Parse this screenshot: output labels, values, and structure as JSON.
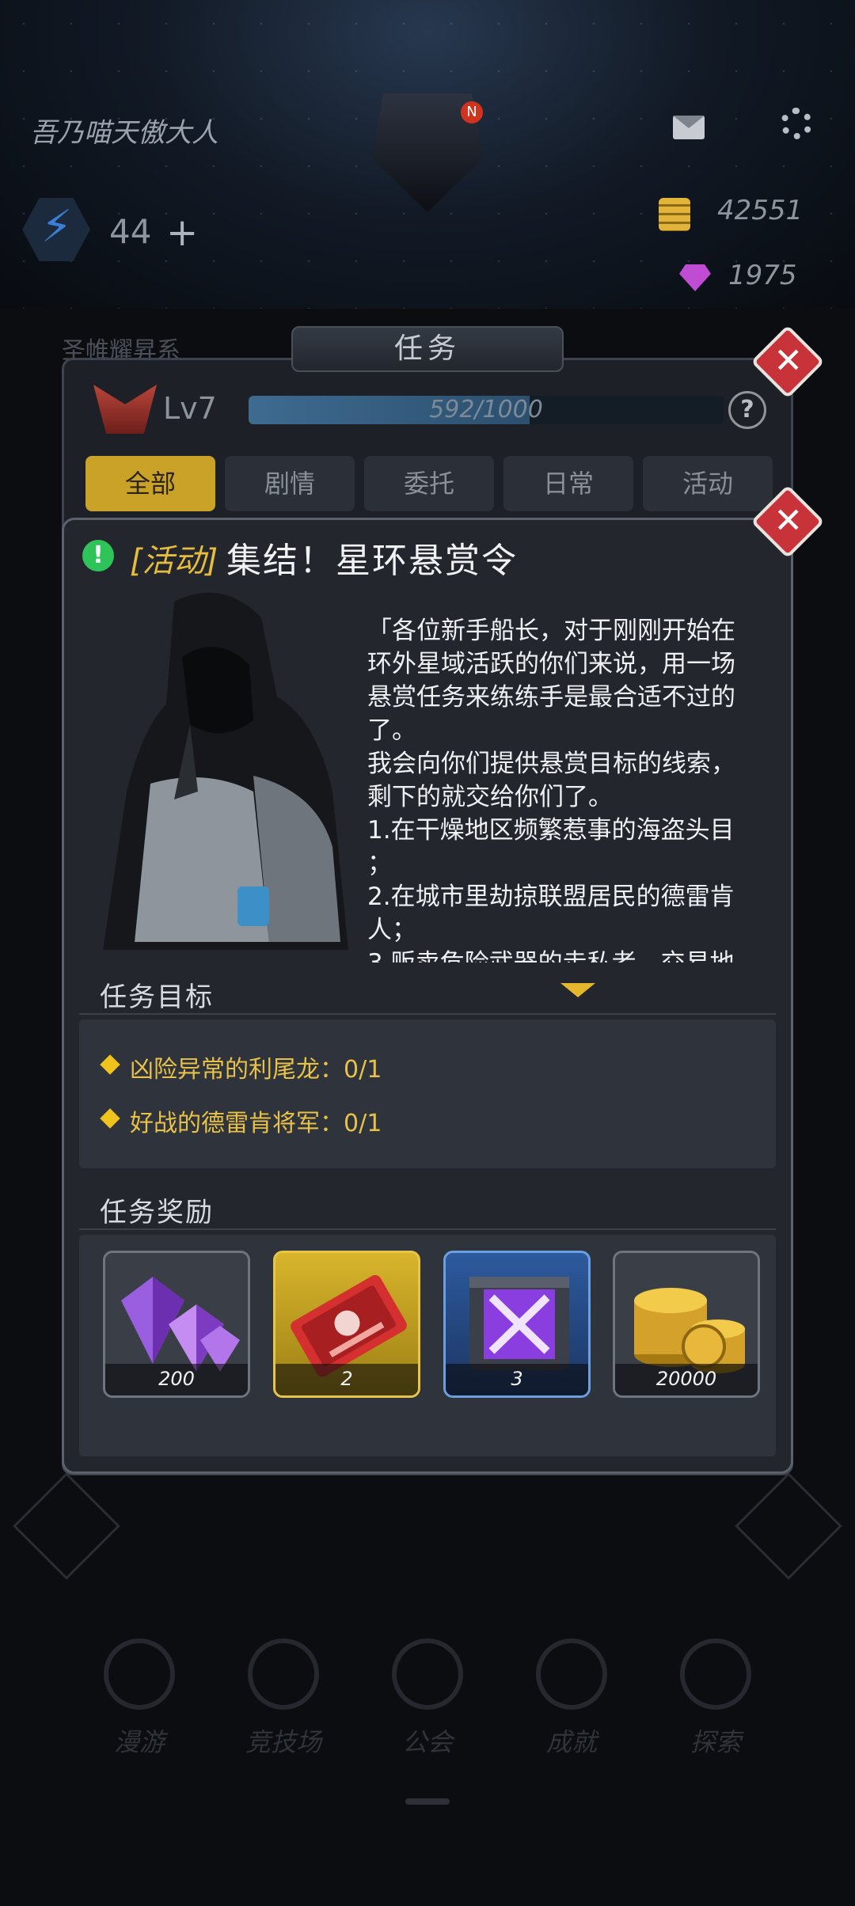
{
  "header": {
    "player_name": "吾乃喵天傲大人",
    "avatar_badge": "N",
    "energy": "44",
    "energy_add": "+",
    "coins": "42551",
    "gems": "1975"
  },
  "background": {
    "partial_text": "圣帷耀昇系",
    "nav": [
      {
        "label": "漫游"
      },
      {
        "label": "竞技场"
      },
      {
        "label": "公会"
      },
      {
        "label": "成就"
      },
      {
        "label": "探索"
      }
    ]
  },
  "mission_panel": {
    "title": "任务",
    "level": "Lv7",
    "xp": 592,
    "xp_max": 1000,
    "xp_text": "592/1000",
    "help": "?",
    "close": "✕",
    "tabs": [
      {
        "label": "全部",
        "active": true
      },
      {
        "label": "剧情",
        "active": false
      },
      {
        "label": "委托",
        "active": false
      },
      {
        "label": "日常",
        "active": false
      },
      {
        "label": "活动",
        "active": false
      }
    ]
  },
  "detail": {
    "close": "✕",
    "alert": "!",
    "tag": "[活动]",
    "title": "集结！星环悬赏令",
    "story": "「各位新手船长，对于刚刚开始在\n环外星域活跃的你们来说，用一场\n悬赏任务来练练手是最合适不过的\n了。\n我会向你们提供悬赏目标的线索，\n剩下的就交给你们了。\n1.在干燥地区频繁惹事的海盗头目\n；\n2.在城市里劫掠联盟居民的德雷肯\n人；\n3.贩卖危险武器的走私者，交易地",
    "objectives_title": "任务目标",
    "objectives": [
      {
        "text": "凶险异常的利尾龙：0/1"
      },
      {
        "text": "好战的德雷肯将军：0/1"
      }
    ],
    "rewards_title": "任务奖励",
    "rewards": [
      {
        "icon": "purple-gems-icon",
        "count": "200"
      },
      {
        "icon": "red-ticket-icon",
        "count": "2"
      },
      {
        "icon": "purple-crate-icon",
        "count": "3"
      },
      {
        "icon": "gold-coins-icon",
        "count": "20000"
      }
    ]
  },
  "colors": {
    "accent_gold": "#c9a227",
    "event_tag": "#e6bc3d",
    "close_red": "#c8333a",
    "alert_green": "#2fc45a"
  }
}
